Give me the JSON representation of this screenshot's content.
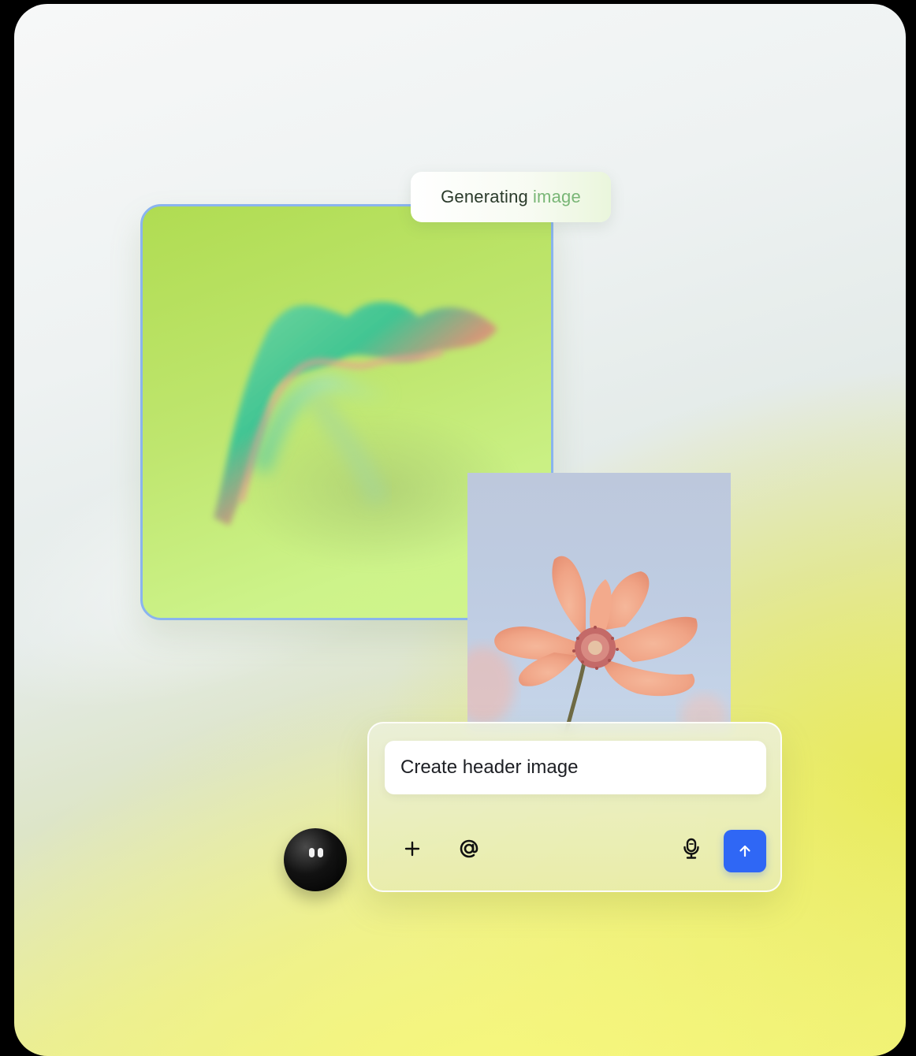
{
  "status": {
    "word1": "Generating",
    "word2": "image"
  },
  "composer": {
    "input_value": "Create header image",
    "add_icon": "plus-icon",
    "mention_icon": "at-icon",
    "mic_icon": "microphone-icon",
    "send_icon": "arrow-up-icon"
  },
  "colors": {
    "accent": "#2f67f5",
    "status_highlight": "#79b676",
    "card_border": "#8ab4ee"
  }
}
